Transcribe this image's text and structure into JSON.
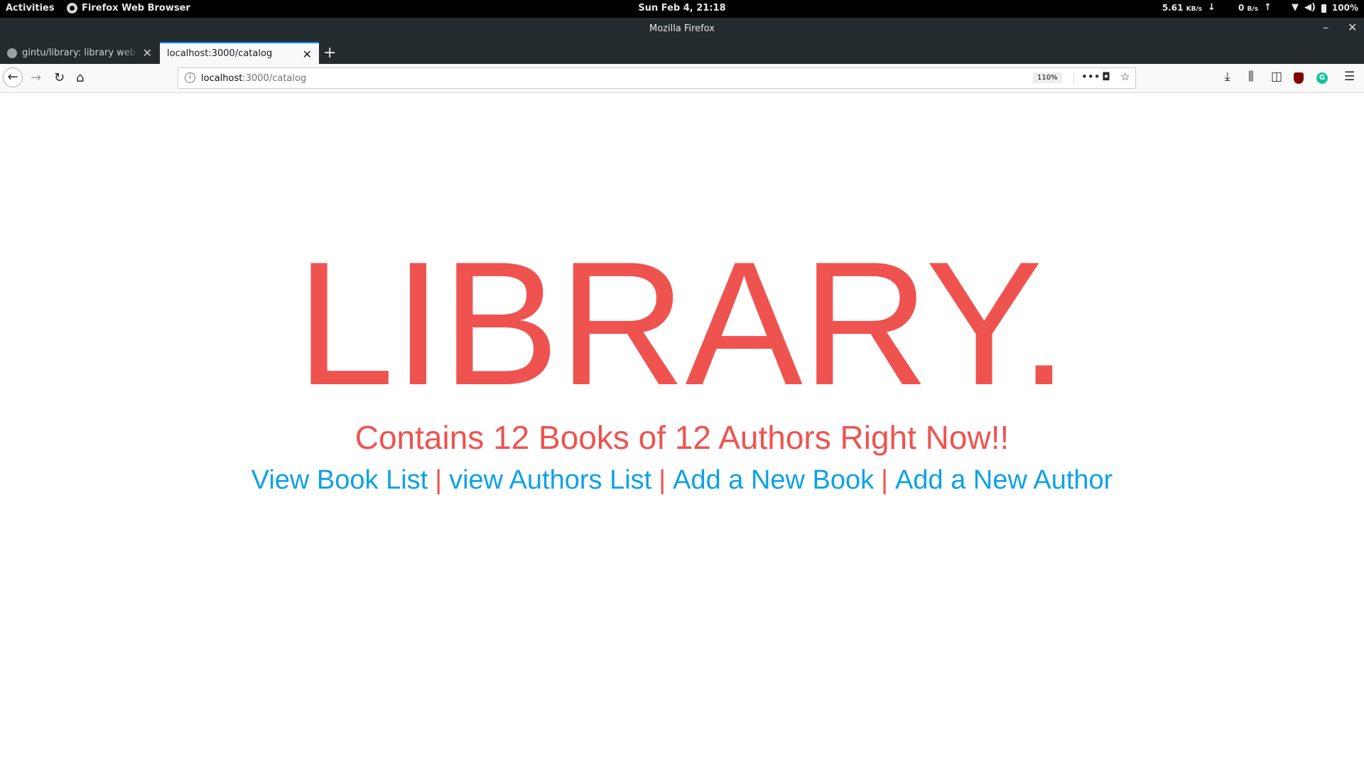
{
  "system_bar": {
    "activities": "Activities",
    "app_name": "Firefox Web Browser",
    "clock": "Sun Feb  4, 21:18",
    "download_rate": "5.61",
    "download_unit": "KB/s",
    "upload_rate": "0",
    "upload_unit": "B/s",
    "battery": "100%"
  },
  "window": {
    "title": "Mozilla Firefox"
  },
  "tabs": [
    {
      "label": "gintu/library: library web app",
      "active": false
    },
    {
      "label": "localhost:3000/catalog",
      "active": true
    }
  ],
  "navbar": {
    "url_host": "localhost",
    "url_path": ":3000/catalog",
    "zoom": "110%"
  },
  "page": {
    "title": "LIBRARY.",
    "subtitle": "Contains 12 Books of 12 Authors Right Now!!",
    "links": [
      {
        "label": "View Book List"
      },
      {
        "label": "view Authors List"
      },
      {
        "label": "Add a New Book"
      },
      {
        "label": "Add a New Author"
      }
    ],
    "separator": "|"
  },
  "colors": {
    "accent_red": "#ef5350",
    "link_blue": "#0ea1e8",
    "tab_highlight": "#0a84ff"
  }
}
